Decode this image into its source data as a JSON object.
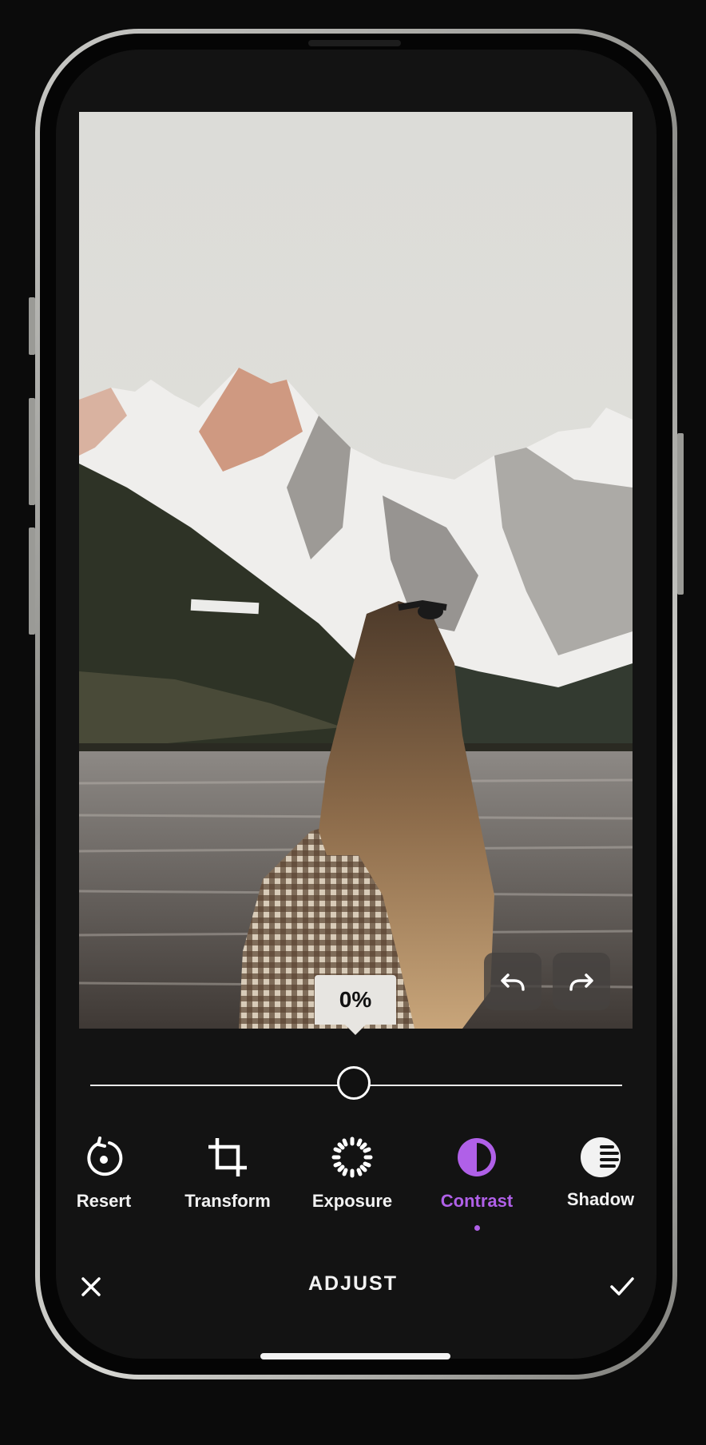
{
  "editor": {
    "adjustment_value": "0%",
    "slider_value_percent": 0,
    "undo_icon": "undo-icon",
    "redo_icon": "redo-icon"
  },
  "tools": [
    {
      "label": "Resert",
      "icon": "reset-icon"
    },
    {
      "label": "Transform",
      "icon": "crop-icon"
    },
    {
      "label": "Exposure",
      "icon": "exposure-icon"
    },
    {
      "label": "Contrast",
      "icon": "contrast-icon",
      "active": true
    },
    {
      "label": "Shadow",
      "icon": "shadow-icon"
    }
  ],
  "bottom_bar": {
    "title": "ADJUST",
    "cancel_icon": "close-icon",
    "confirm_icon": "check-icon"
  },
  "colors": {
    "accent": "#b060e8",
    "background": "#131313",
    "text": "#f2f2f2"
  }
}
